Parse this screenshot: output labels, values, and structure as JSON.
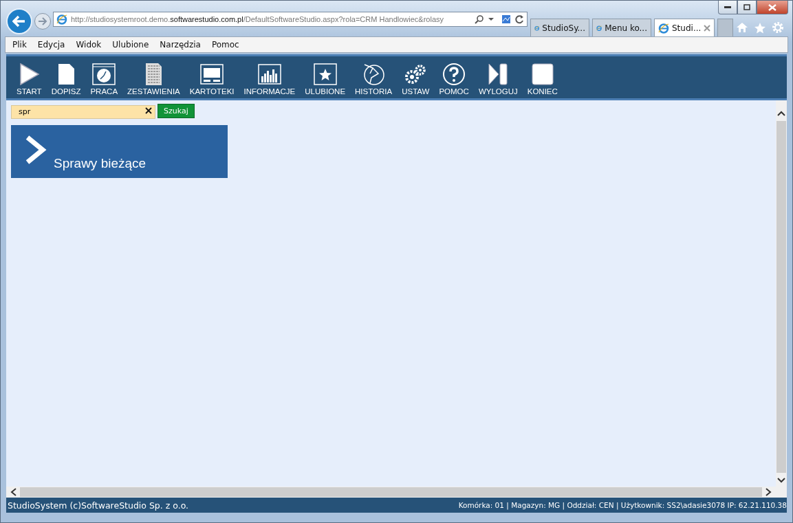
{
  "browser": {
    "address": "http://studiosystemroot.demo.**softwarestudio.com.pl**/DefaultSoftwareStudio.aspx?rola=CRM Handlowiec&rolasy",
    "tabs": [
      {
        "label": "StudioSy...",
        "selected": false
      },
      {
        "label": "Menu ko...",
        "selected": false
      },
      {
        "label": "Studi...",
        "selected": true
      }
    ]
  },
  "menu": [
    "Plik",
    "Edycja",
    "Widok",
    "Ulubione",
    "Narzędzia",
    "Pomoc"
  ],
  "toolbar": [
    {
      "kind": "start",
      "label": "START"
    },
    {
      "kind": "page",
      "label": "DOPISZ"
    },
    {
      "kind": "clock",
      "label": "PRACA"
    },
    {
      "kind": "document",
      "label": "ZESTAWIENIA"
    },
    {
      "kind": "window",
      "label": "KARTOTEKI"
    },
    {
      "kind": "chart",
      "label": "INFORMACJE"
    },
    {
      "kind": "star",
      "label": "ULUBIONE"
    },
    {
      "kind": "history",
      "label": "HISTORIA"
    },
    {
      "kind": "gears",
      "label": "USTAW"
    },
    {
      "kind": "help",
      "label": "POMOC"
    },
    {
      "kind": "logout",
      "label": "WYLOGUJ"
    },
    {
      "kind": "stop",
      "label": "KONIEC"
    }
  ],
  "search": {
    "value": "spr",
    "button": "Szukaj"
  },
  "tiles": [
    {
      "label": "Sprawy bieżące"
    }
  ],
  "status_bar": {
    "left": "StudioSystem (c)SoftwareStudio Sp. z o.o.",
    "right": "Komórka: 01 | Magazyn: MG | Oddział: CEN | Użytkownik: SS2\\adasie3078 IP: 62.21.110.38"
  }
}
